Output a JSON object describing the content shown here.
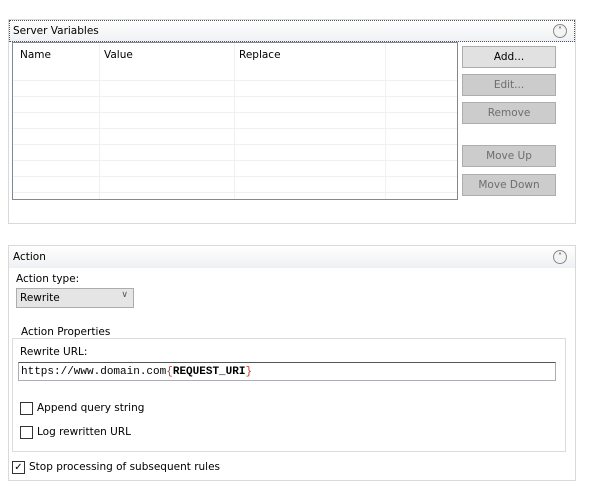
{
  "server_variables": {
    "title": "Server Variables",
    "columns": [
      "Name",
      "Value",
      "Replace"
    ],
    "buttons": {
      "add": "Add...",
      "edit": "Edit...",
      "remove": "Remove",
      "move_up": "Move Up",
      "move_down": "Move Down"
    }
  },
  "action": {
    "title": "Action",
    "action_type_label": "Action type:",
    "action_type_value": "Rewrite",
    "properties_legend": "Action Properties",
    "rewrite_url_label": "Rewrite URL:",
    "rewrite_url_prefix": "https://www.domain.com",
    "rewrite_url_open": "{",
    "rewrite_url_var": "REQUEST_URI",
    "rewrite_url_close": "}",
    "append_query_string": {
      "label": "Append query string",
      "checked": false
    },
    "log_rewritten_url": {
      "label": "Log rewritten URL",
      "checked": false
    },
    "stop_processing": {
      "label": "Stop processing of subsequent rules",
      "checked": true
    }
  }
}
